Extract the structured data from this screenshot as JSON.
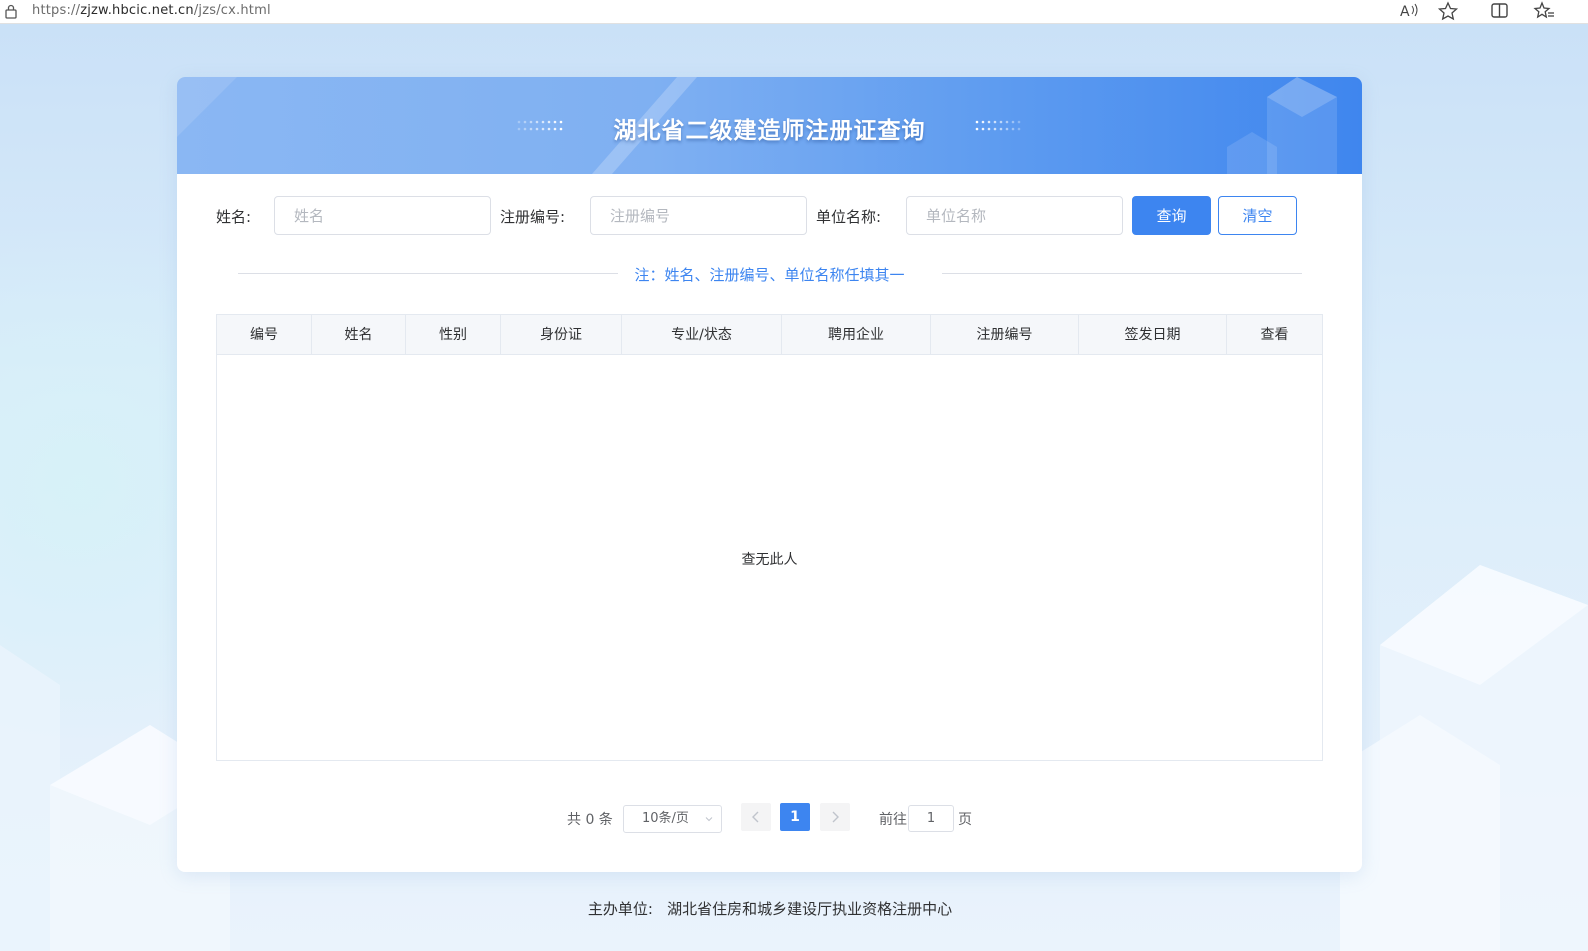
{
  "browser": {
    "url_prefix": "https://",
    "url_host": "zjzw.hbcic.net.cn",
    "url_path": "/jzs/cx.html"
  },
  "banner": {
    "title": "湖北省二级建造师注册证查询"
  },
  "search": {
    "name_label": "姓名:",
    "name_placeholder": "姓名",
    "reg_label": "注册编号:",
    "reg_placeholder": "注册编号",
    "org_label": "单位名称:",
    "org_placeholder": "单位名称",
    "query_button": "查询",
    "clear_button": "清空"
  },
  "note": "注：姓名、注册编号、单位名称任填其一",
  "table": {
    "columns": [
      "编号",
      "姓名",
      "性别",
      "身份证",
      "专业/状态",
      "聘用企业",
      "注册编号",
      "签发日期",
      "查看"
    ],
    "rows": [],
    "empty_text": "查无此人"
  },
  "pagination": {
    "total_text": "共 0 条",
    "page_size": "10条/页",
    "current_page": "1",
    "goto_label": "前往",
    "goto_value": "1",
    "page_suffix": "页"
  },
  "footer": {
    "text": "主办单位:   湖北省住房和城乡建设厅执业资格注册中心"
  },
  "colors": {
    "primary": "#3d85f0",
    "border": "#dcdfe6",
    "header_bg": "#f5f7fa"
  }
}
